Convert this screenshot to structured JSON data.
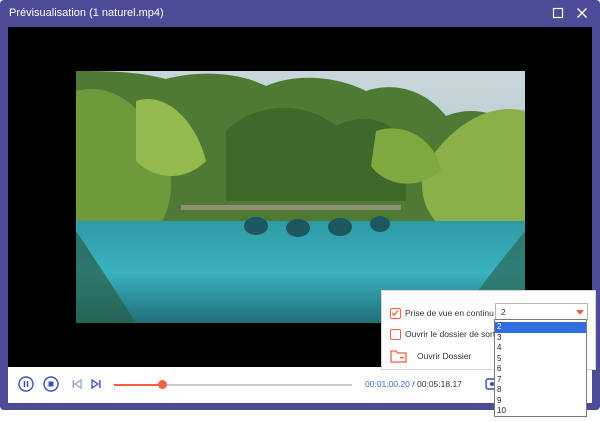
{
  "window": {
    "title": "Prévisualisation (1 naturel.mp4)"
  },
  "player": {
    "progress_fraction": 0.205,
    "time_current": "00:01:00.20",
    "time_separator": " / ",
    "time_total": "00:05:18.17"
  },
  "capture_menu": {
    "continuous_label": "Prise de vue en continu",
    "continuous_checked": true,
    "burst_value": "2",
    "open_folder_after_label": "Ouvrir le dossier de sortie",
    "open_folder_after_checked": false,
    "open_folder_button": "Ouvrir Dossier"
  },
  "burst_options": [
    "2",
    "3",
    "4",
    "5",
    "6",
    "7",
    "8",
    "9",
    "10"
  ],
  "colors": {
    "accent": "#f0623d",
    "window_frame": "#4b4b96",
    "highlight": "#2f6de0",
    "time_current": "#3c6ad6"
  }
}
